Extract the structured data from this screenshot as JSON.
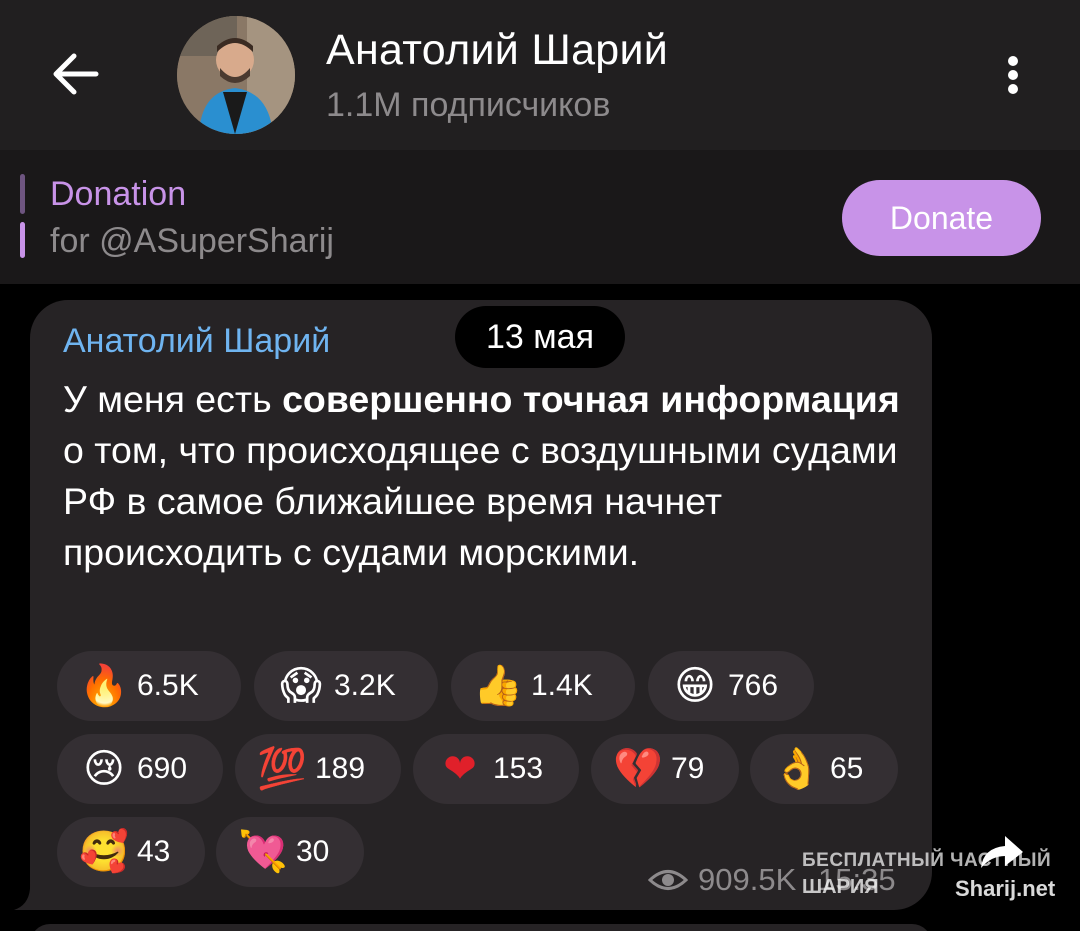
{
  "header": {
    "title": "Анатолий Шарий",
    "subtitle": "1.1M подписчиков",
    "back_icon": "arrow-left-icon",
    "menu_icon": "more-vertical-icon"
  },
  "pinned": {
    "title": "Donation",
    "subtitle": "for @ASuperSharij",
    "button_label": "Donate",
    "accent": "#c893e8"
  },
  "message": {
    "author": "Анатолий Шарий",
    "date": "13 мая",
    "segments": [
      {
        "text": "У меня есть ",
        "bold": false
      },
      {
        "text": "совершенно точная информация",
        "bold": true
      },
      {
        "text": " о том, что происходящее с воздушными судами РФ в самое ближайшее время начнет происходить с судами морскими.",
        "bold": false
      }
    ],
    "reactions": [
      {
        "emoji": "🔥",
        "icon": "fire-icon",
        "count": "6.5K"
      },
      {
        "emoji": "😱",
        "icon": "screaming-face-icon",
        "count": "3.2K"
      },
      {
        "emoji": "👍",
        "icon": "thumbs-up-icon",
        "count": "1.4K"
      },
      {
        "emoji": "😁",
        "icon": "grinning-face-icon",
        "count": "766"
      },
      {
        "emoji": "😢",
        "icon": "crying-face-icon",
        "count": "690"
      },
      {
        "emoji": "💯",
        "icon": "hundred-points-icon",
        "count": "189"
      },
      {
        "emoji": "❤",
        "icon": "red-heart-icon",
        "count": "153"
      },
      {
        "emoji": "💔",
        "icon": "broken-heart-icon",
        "count": "79"
      },
      {
        "emoji": "👌",
        "icon": "ok-hand-icon",
        "count": "65"
      },
      {
        "emoji": "🥰",
        "icon": "smiling-face-hearts-icon",
        "count": "43"
      },
      {
        "emoji": "💘",
        "icon": "heart-arrow-icon",
        "count": "30"
      }
    ],
    "views": "909.5K",
    "time": "15:35",
    "share_icon": "share-arrow-icon"
  },
  "watermark": {
    "line1": "БЕСПЛАТНЫЙ ЧАСТНЫЙ",
    "line2": "ШАРИЯ",
    "line3": "Sharij.net"
  }
}
